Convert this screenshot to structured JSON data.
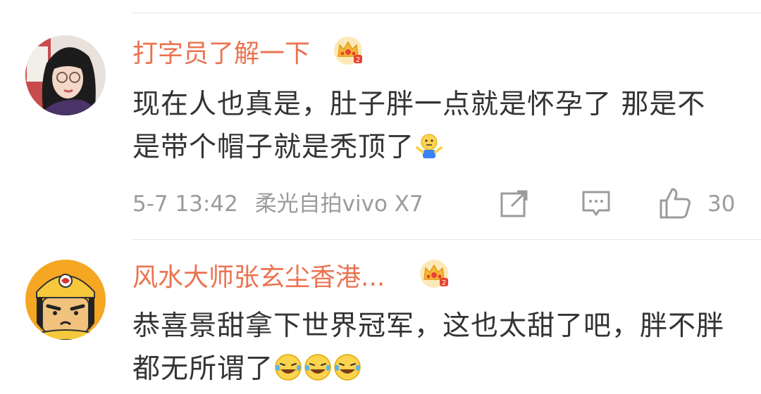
{
  "comments": [
    {
      "username": "打字员了解一下",
      "badge_icon": "vip-crown-icon",
      "text": "现在人也真是，肚子胖一点就是怀孕了 那是不是带个帽子就是秃顶了",
      "text_emojis": [
        "shrug-emoji"
      ],
      "timestamp": "5-7 13:42",
      "source": "柔光自拍vivo X7",
      "likes": "30",
      "actions": [
        "share-icon",
        "comment-icon",
        "like-icon"
      ]
    },
    {
      "username": "风水大师张玄尘香港...",
      "badge_icon": "vip-crown-icon",
      "text": "恭喜景甜拿下世界冠军，这也太甜了吧，胖不胖都无所谓了",
      "text_emojis": [
        "laughing-tears-emoji",
        "laughing-tears-emoji",
        "laughing-tears-emoji"
      ]
    }
  ],
  "colors": {
    "username": "#eb7350",
    "body_text": "#333333",
    "meta_text": "#9b9b9b",
    "divider": "#e6e6e6",
    "crown_gold": "#f5b83a",
    "crown_red": "#e8412f"
  }
}
